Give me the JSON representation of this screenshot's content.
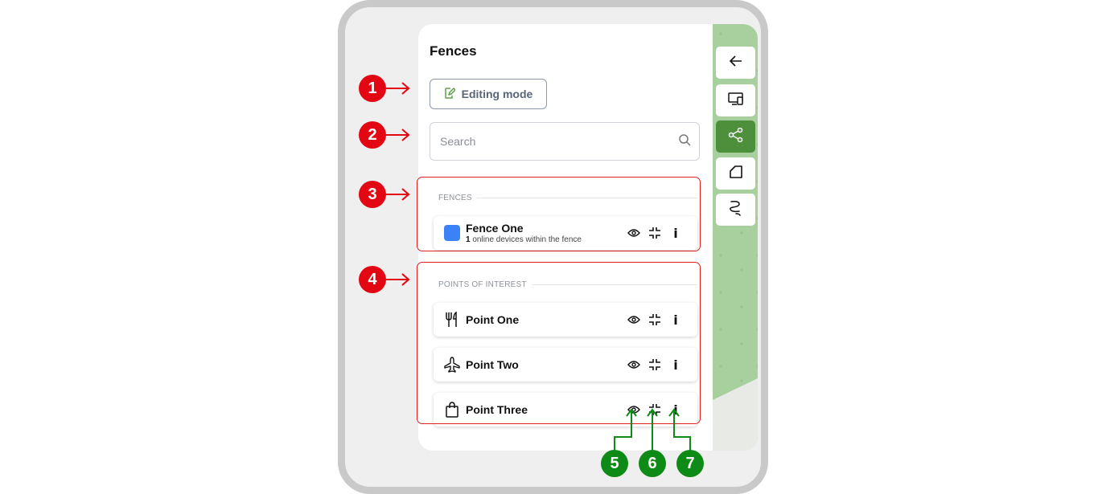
{
  "panel": {
    "title": "Fences",
    "editing_mode_label": "Editing mode",
    "search_placeholder": "Search"
  },
  "fences_section": {
    "label": "FENCES",
    "items": [
      {
        "name": "Fence One",
        "device_count": "1",
        "device_text": "online devices within the fence",
        "color": "#3b82f6"
      }
    ]
  },
  "poi_section": {
    "label": "POINTS OF INTEREST",
    "items": [
      {
        "name": "Point One",
        "icon": "fork-knife-icon"
      },
      {
        "name": "Point Two",
        "icon": "airplane-icon"
      },
      {
        "name": "Point Three",
        "icon": "shopping-bag-icon"
      }
    ]
  },
  "sidebar": {
    "buttons": [
      {
        "icon": "arrow-left-icon"
      },
      {
        "icon": "devices-icon"
      },
      {
        "icon": "share-nodes-icon",
        "active": true
      },
      {
        "icon": "fence-shape-icon"
      },
      {
        "icon": "route-icon"
      }
    ]
  },
  "annotations": {
    "red": [
      "1",
      "2",
      "3",
      "4"
    ],
    "green": [
      "5",
      "6",
      "7"
    ]
  },
  "colors": {
    "accent_green": "#4e8f3c",
    "annotation_red": "#e30613",
    "annotation_green": "#0e8a16"
  }
}
